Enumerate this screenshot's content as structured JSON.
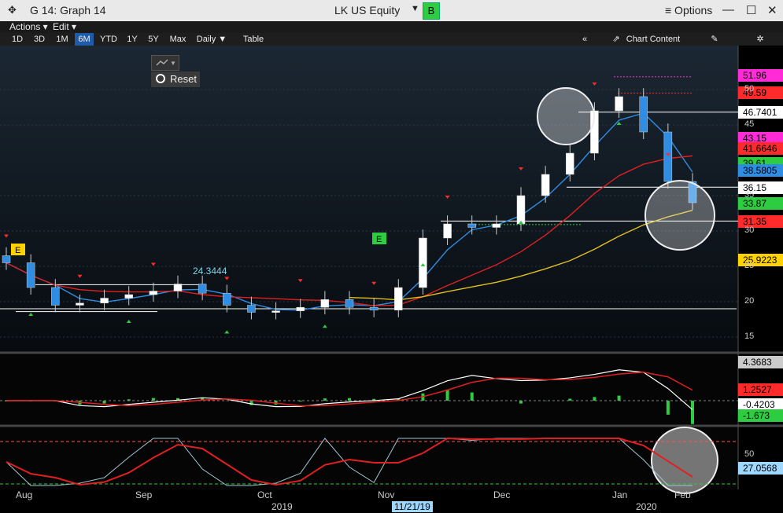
{
  "window": {
    "move_icon": "✥",
    "title": "G 14: Graph 14",
    "ticker": "LK US Equity",
    "ticker_badge": "B",
    "options_label": "≡ Options",
    "minimize_icon": "—",
    "maximize_icon": "☐",
    "close_icon": "✕"
  },
  "menu": {
    "actions": "Actions ▾",
    "edit": "Edit ▾"
  },
  "toolbar": {
    "ranges": [
      "1D",
      "3D",
      "1M",
      "6M",
      "YTD",
      "1Y",
      "5Y",
      "Max"
    ],
    "active_range": "6M",
    "period": "Daily ▼",
    "table": "Table",
    "collapse": "«",
    "chart_content": "Chart Content",
    "edit_icon": "✎",
    "gear_icon": "✲"
  },
  "reset_label": "Reset",
  "price_tags": [
    {
      "value": "51.96",
      "bg": "#ff2bd6",
      "color": "#000"
    },
    {
      "value": "49.59",
      "bg": "#ff2a2a",
      "color": "#000"
    },
    {
      "value": "46.7401",
      "bg": "#ffffff",
      "color": "#000"
    },
    {
      "value": "43.15",
      "bg": "#ff2bd6",
      "color": "#000"
    },
    {
      "value": "41.6646",
      "bg": "#ff2a2a",
      "color": "#000"
    },
    {
      "value": "39.61",
      "bg": "#2ecc40",
      "color": "#000"
    },
    {
      "value": "38.5805",
      "bg": "#2f8de4",
      "color": "#000"
    },
    {
      "value": "36.15",
      "bg": "#ffffff",
      "color": "#000"
    },
    {
      "value": "33.87",
      "bg": "#2ecc40",
      "color": "#000"
    },
    {
      "value": "31.35",
      "bg": "#ff2a2a",
      "color": "#000"
    },
    {
      "value": "25.9223",
      "bg": "#ffd200",
      "color": "#000"
    }
  ],
  "price_axis": [
    "50",
    "45",
    "35",
    "30",
    "25",
    "20",
    "15"
  ],
  "macd_tags": [
    {
      "value": "4.3683",
      "bg": "#cccccc",
      "color": "#000"
    },
    {
      "value": "1.2527",
      "bg": "#ff2a2a",
      "color": "#000"
    },
    {
      "value": "-0.4203",
      "bg": "#ffffff",
      "color": "#000"
    },
    {
      "value": "-1.673",
      "bg": "#2ecc40",
      "color": "#000"
    }
  ],
  "stoch_axis": [
    "50"
  ],
  "stoch_tag": {
    "value": "27.0568",
    "bg": "#9fd7ff",
    "color": "#000"
  },
  "annotations": {
    "upper_level": "24.3444",
    "earnings_1": "E",
    "earnings_2": "E"
  },
  "x_months": [
    "Aug",
    "Sep",
    "Oct",
    "Nov",
    "Dec",
    "Jan",
    "Feb"
  ],
  "x_years": [
    "2019",
    "2020"
  ],
  "crosshair_date": "11/21/19",
  "chart_data": {
    "type": "candlestick",
    "title": "",
    "xlabel": "",
    "ylabel": "",
    "ylim": [
      14,
      54
    ],
    "x": [
      "2019-07-22",
      "2019-07-29",
      "2019-08-05",
      "2019-08-12",
      "2019-08-19",
      "2019-08-26",
      "2019-09-02",
      "2019-09-09",
      "2019-09-16",
      "2019-09-23",
      "2019-09-30",
      "2019-10-07",
      "2019-10-14",
      "2019-10-21",
      "2019-10-28",
      "2019-11-04",
      "2019-11-11",
      "2019-11-18",
      "2019-11-25",
      "2019-12-02",
      "2019-12-09",
      "2019-12-16",
      "2019-12-23",
      "2019-12-30",
      "2020-01-06",
      "2020-01-13",
      "2020-01-20",
      "2020-01-27",
      "2020-02-03"
    ],
    "close": [
      25.5,
      22,
      19.5,
      19.8,
      20.5,
      21,
      21.5,
      22.5,
      21.2,
      19.5,
      18.5,
      18.7,
      19.2,
      20.3,
      19.2,
      18.8,
      22,
      29,
      31,
      30.5,
      31,
      35,
      38,
      41,
      47,
      49,
      44,
      37,
      34
    ]
  },
  "colors": {
    "up": "#ffffff",
    "down": "#2f8de4",
    "ma_fast": "#2f8de4",
    "ma_mid": "#e02020",
    "ma_slow": "#e0c020",
    "macd_line": "#ffffff",
    "signal": "#e02020",
    "hist": "#2ecc40"
  }
}
